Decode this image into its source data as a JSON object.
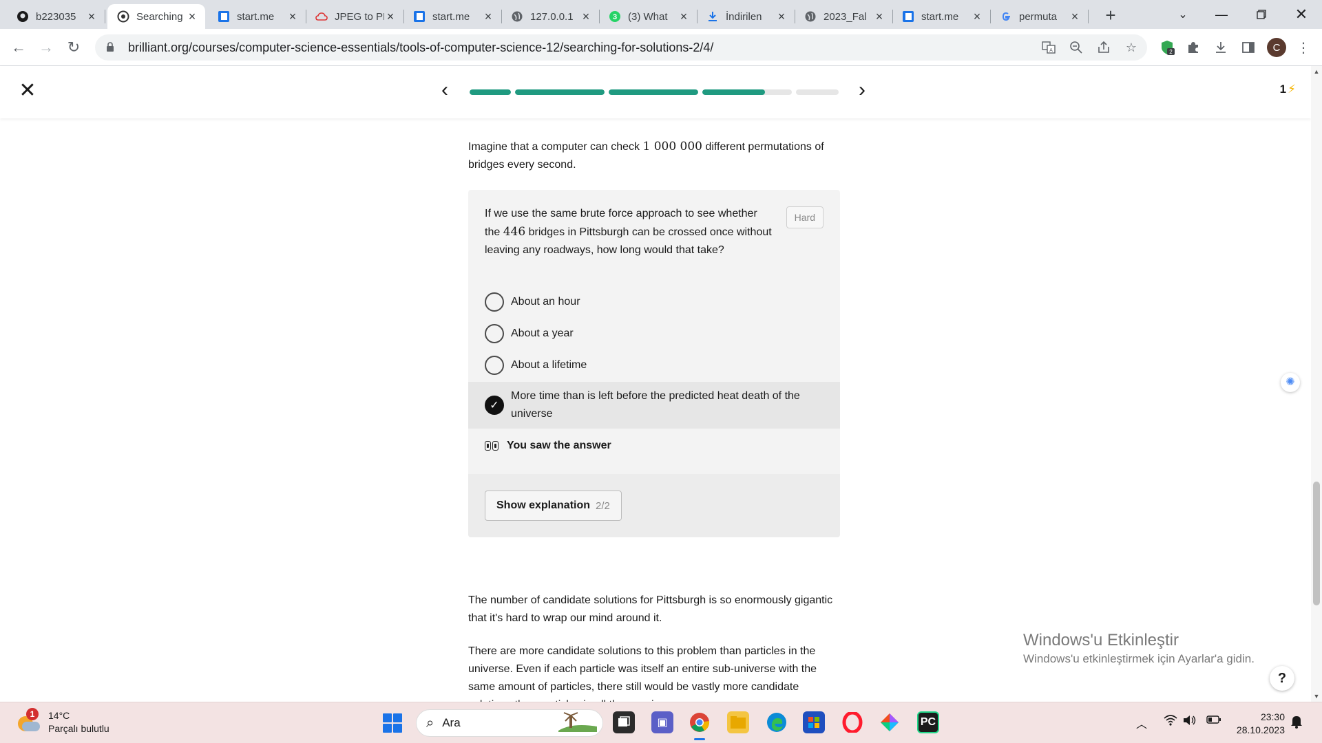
{
  "browser": {
    "tabs": [
      {
        "title": "b223035",
        "icon": "github-icon"
      },
      {
        "title": "Searching",
        "icon": "brilliant-icon",
        "active": true
      },
      {
        "title": "start.me",
        "icon": "startme-icon"
      },
      {
        "title": "JPEG to PDF",
        "icon": "cloud-icon"
      },
      {
        "title": "start.me",
        "icon": "startme-icon"
      },
      {
        "title": "127.0.0.1",
        "icon": "globe-icon"
      },
      {
        "title": "(3) What",
        "icon": "whatsapp-icon"
      },
      {
        "title": "İndirilen",
        "icon": "download-icon"
      },
      {
        "title": "2023_Fal",
        "icon": "globe-icon"
      },
      {
        "title": "start.me",
        "icon": "startme-icon"
      },
      {
        "title": "permuta",
        "icon": "google-icon"
      }
    ],
    "url": "brilliant.org/courses/computer-science-essentials/tools-of-computer-science-12/searching-for-solutions-2/4/",
    "profile_initial": "C",
    "extension_badge": "2"
  },
  "lesson": {
    "progress": {
      "completed_segments": 3,
      "current_segment_fill": 0.7,
      "total_segments": 5
    },
    "streak_count": "1",
    "intro": {
      "before": "Imagine that a computer can check ",
      "number": "1 000 000",
      "after": " different permutations of bridges every second."
    },
    "question": {
      "before": "If we use the same brute force approach to see whether the ",
      "number": "446",
      "after": " bridges in Pittsburgh can be crossed once without leaving any roadways, how long would that take?",
      "difficulty": "Hard",
      "options": [
        "About an hour",
        "About a year",
        "About a lifetime",
        "More time than is left before the predicted heat death of the universe"
      ],
      "selected_option": 3,
      "status": "You saw the answer",
      "explain_button": "Show explanation",
      "explain_count": "2/2"
    },
    "body": [
      "The number of candidate solutions for Pittsburgh is so enormously gigantic that it's hard to wrap our mind around it.",
      "There are more candidate solutions to this problem than particles in the universe. Even if each particle was itself an entire sub-universe with the same amount of particles, there still would be vastly more candidate solutions than particles in all those universes."
    ]
  },
  "overlay": {
    "watermark_title": "Windows'u Etkinleştir",
    "watermark_subtitle": "Windows'u etkinleştirmek için Ayarlar'a gidin.",
    "help_label": "?"
  },
  "taskbar": {
    "weather_temp": "14°C",
    "weather_desc": "Parçalı bulutlu",
    "weather_badge": "1",
    "search_placeholder": "Ara",
    "time": "23:30",
    "date": "28.10.2023",
    "accent_color": "#1f9a80"
  }
}
